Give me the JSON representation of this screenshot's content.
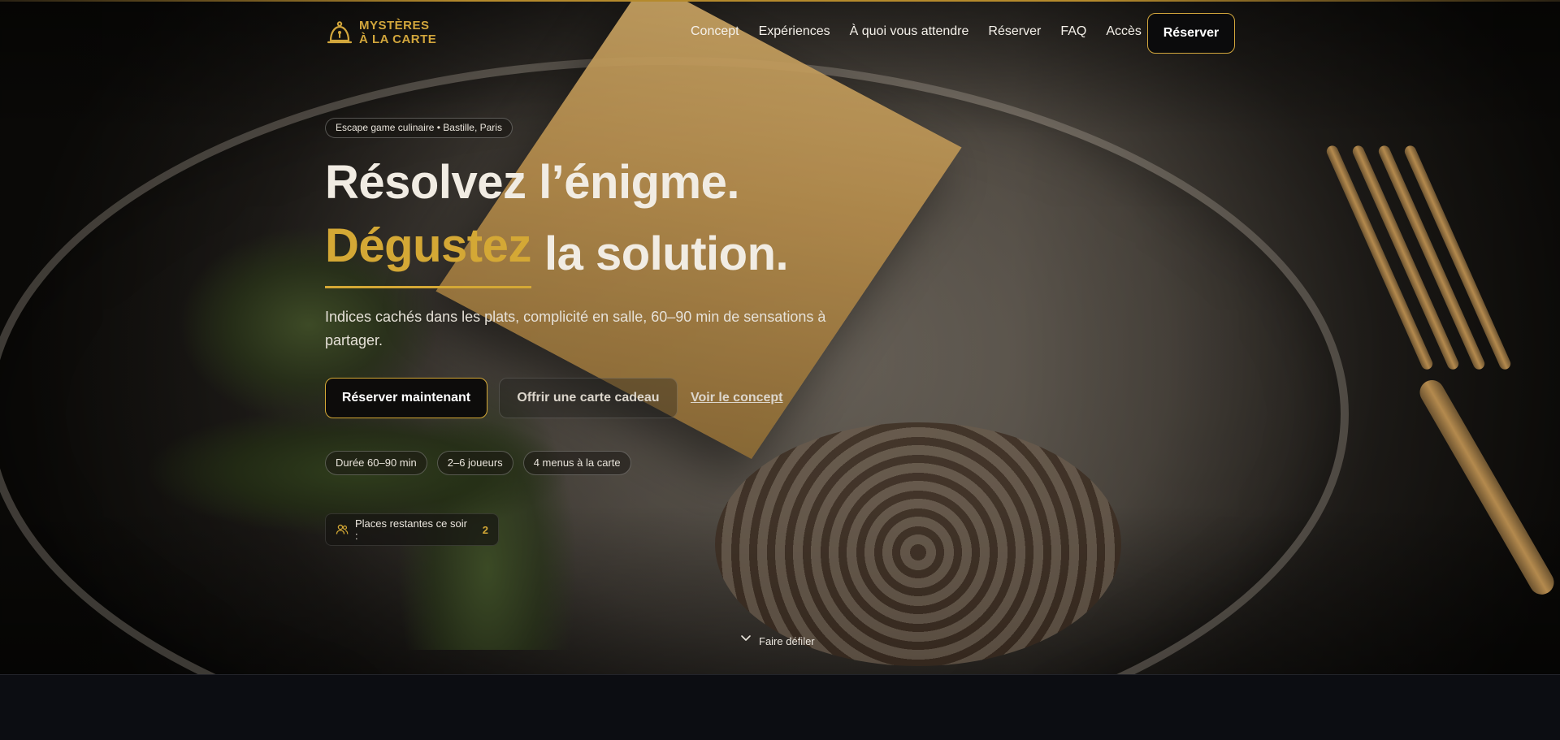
{
  "brand": {
    "line1": "MYSTÈRES",
    "line2": "À LA CARTE",
    "accent": "#d4a835"
  },
  "nav": {
    "items": [
      "Concept",
      "Expériences",
      "À quoi vous attendre",
      "Réserver",
      "FAQ",
      "Accès"
    ],
    "cta": "Réserver"
  },
  "hero": {
    "tag": "Escape game culinaire • Bastille, Paris",
    "title_line1": "Résolvez l’énigme.",
    "title_highlight": "Dégustez",
    "title_rest": "la solution.",
    "subtitle": "Indices cachés dans les plats, complicité en salle, 60–90 min de sensations à partager.",
    "primary_button": "Réserver maintenant",
    "secondary_button": "Offrir une carte cadeau",
    "link": "Voir le concept",
    "chips": [
      "Durée 60–90 min",
      "2–6 joueurs",
      "4 menus à la carte"
    ],
    "places_label": "Places restantes ce soir :",
    "places_count": "2",
    "scroll_label": "Faire défiler"
  },
  "icons": {
    "logo": "cloche-icon",
    "users": "users-icon",
    "scroll": "chevron-down-icon"
  }
}
